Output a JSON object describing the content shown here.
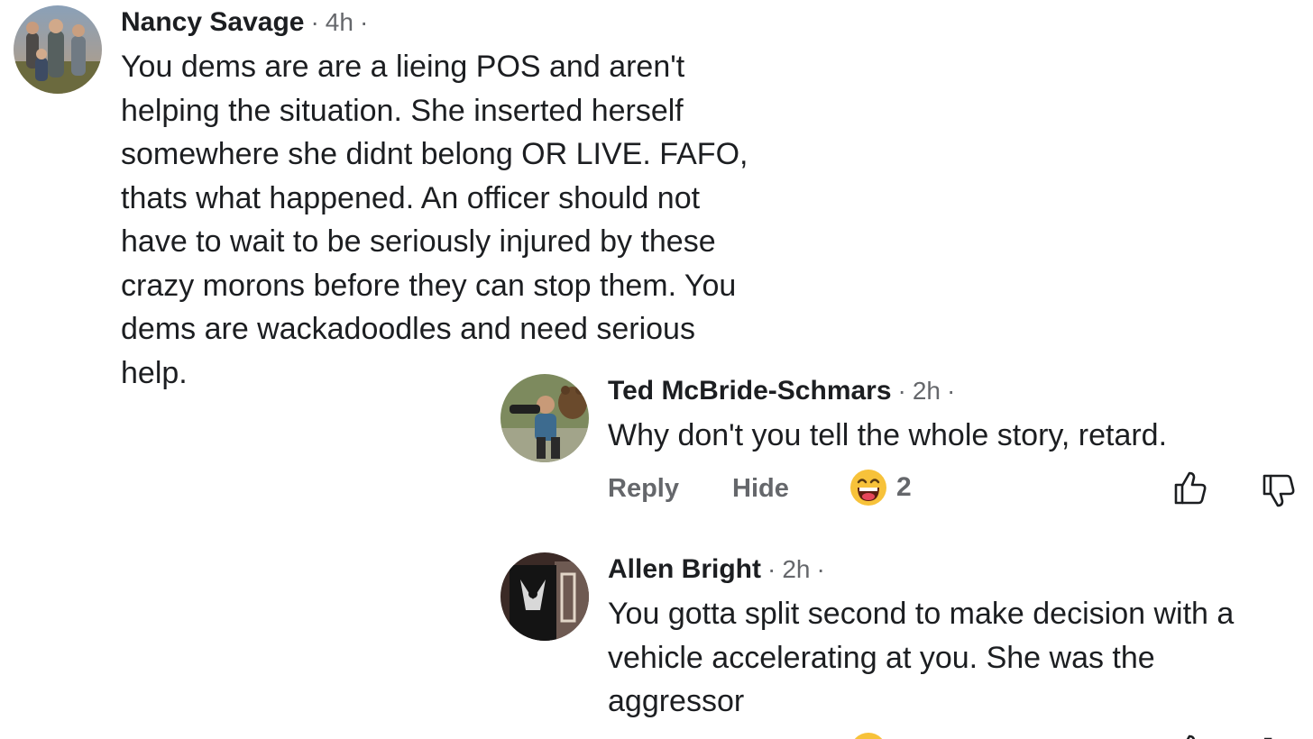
{
  "comments": [
    {
      "author": "Nancy Savage",
      "time": "4h",
      "separator": "·",
      "avatar_icon": "family-photo-avatar",
      "lines": [
        "You dems are are a lieing POS and aren't",
        "helping the situation. She inserted herself",
        "somewhere she didnt belong OR LIVE. FAFO,",
        "thats what happened. An officer should not",
        "have to wait to be seriously injured by these",
        "crazy morons before they can stop them. You",
        "dems are wackadoodles and need serious",
        "help."
      ]
    }
  ],
  "replies": [
    {
      "author": "Ted McBride-Schmars",
      "time": "2h",
      "separator": "·",
      "avatar_icon": "photographer-with-bear-avatar",
      "text": "Why don't you tell the whole story, retard.",
      "actions": {
        "reply_label": "Reply",
        "hide_label": "Hide",
        "reaction_icon": "laughing-emoji-icon",
        "reaction_count": "2",
        "like_icon": "thumbs-up-icon",
        "dislike_icon": "thumbs-down-icon"
      }
    },
    {
      "author": "Allen Bright",
      "time": "2h",
      "separator": "·",
      "avatar_icon": "dark-graphic-tshirt-avatar",
      "lines": [
        "You gotta split second to make decision with a",
        "vehicle accelerating at you. She was the",
        "aggressor"
      ]
    }
  ],
  "colors": {
    "text_primary": "#1c1e21",
    "text_secondary": "#65676b",
    "background": "#ffffff"
  }
}
